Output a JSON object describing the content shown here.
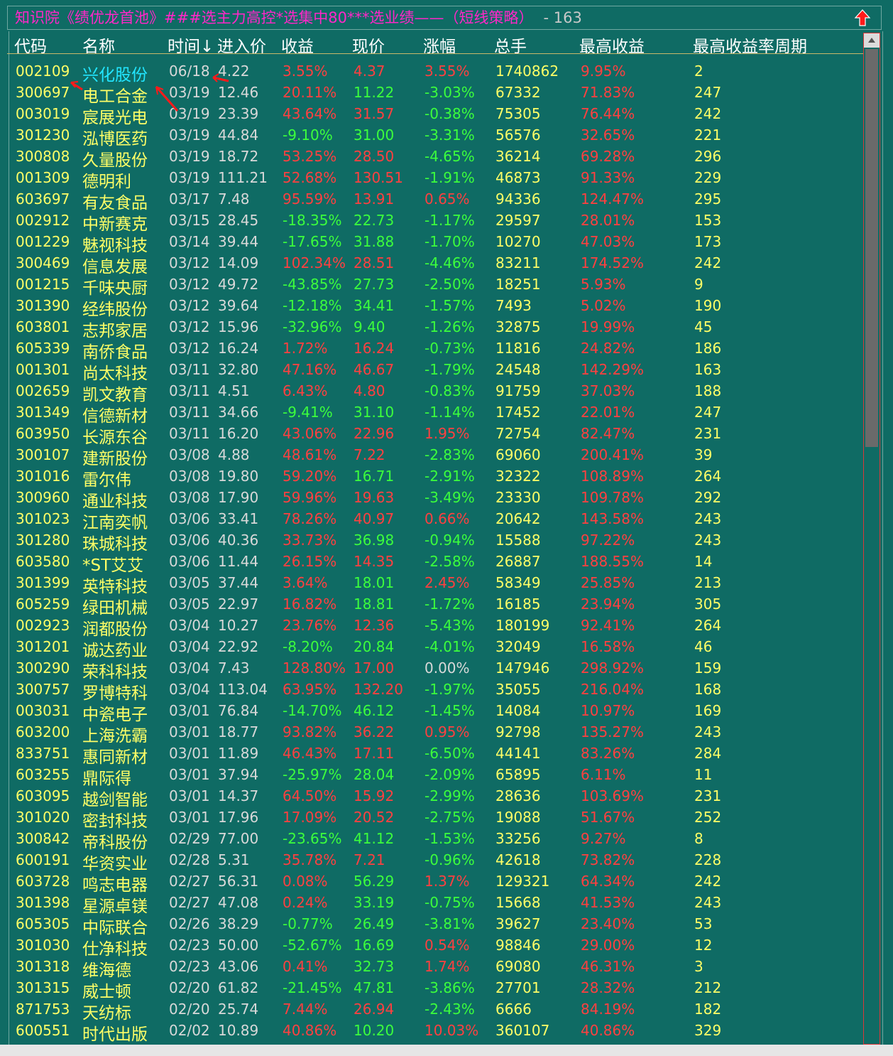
{
  "title": {
    "text": "知识院《绩优龙首池》###选主力高控*选集中80***选业绩——（短线策略）",
    "count": "- 163"
  },
  "headers": {
    "code": "代码",
    "name": "名称",
    "time": "时间↓",
    "entry": "进入价",
    "ret": "收益",
    "price": "现价",
    "chg": "涨幅",
    "vol": "总手",
    "max": "最高收益",
    "period": "最高收益率周期"
  },
  "icons": {
    "up": "up-arrow-icon",
    "annotation": "red-arrow-annotation"
  },
  "colors": {
    "background": "#0f6b64",
    "title": "#ff27c8",
    "code": "#ffff66",
    "positive": "#ff4040",
    "negative": "#3cff3c",
    "selected_name": "#22e5ff"
  },
  "rows": [
    {
      "code": "002109",
      "name": "兴化股份",
      "time": "06/18",
      "entry": "4.22",
      "ret": "3.55%",
      "price": "4.37",
      "chg": "3.55%",
      "vol": "1740862",
      "max": "9.95%",
      "period": "2",
      "sel": true
    },
    {
      "code": "300697",
      "name": "电工合金",
      "time": "03/19",
      "entry": "12.46",
      "ret": "20.11%",
      "price": "11.22",
      "chg": "-3.03%",
      "vol": "67332",
      "max": "71.83%",
      "period": "247"
    },
    {
      "code": "003019",
      "name": "宸展光电",
      "time": "03/19",
      "entry": "23.39",
      "ret": "43.64%",
      "price": "31.57",
      "chg": "-0.38%",
      "vol": "75305",
      "max": "76.44%",
      "period": "242"
    },
    {
      "code": "301230",
      "name": "泓博医药",
      "time": "03/19",
      "entry": "44.84",
      "ret": "-9.10%",
      "price": "31.00",
      "chg": "-3.31%",
      "vol": "56576",
      "max": "32.65%",
      "period": "221"
    },
    {
      "code": "300808",
      "name": "久量股份",
      "time": "03/19",
      "entry": "18.72",
      "ret": "53.25%",
      "price": "28.50",
      "chg": "-4.65%",
      "vol": "36214",
      "max": "69.28%",
      "period": "296"
    },
    {
      "code": "001309",
      "name": "德明利",
      "time": "03/19",
      "entry": "111.21",
      "ret": "52.68%",
      "price": "130.51",
      "chg": "-1.91%",
      "vol": "46873",
      "max": "91.33%",
      "period": "229"
    },
    {
      "code": "603697",
      "name": "有友食品",
      "time": "03/17",
      "entry": "7.48",
      "ret": "95.59%",
      "price": "13.91",
      "chg": "0.65%",
      "vol": "94336",
      "max": "124.47%",
      "period": "295"
    },
    {
      "code": "002912",
      "name": "中新赛克",
      "time": "03/15",
      "entry": "28.45",
      "ret": "-18.35%",
      "price": "22.73",
      "chg": "-1.17%",
      "vol": "29597",
      "max": "28.01%",
      "period": "153"
    },
    {
      "code": "001229",
      "name": "魅视科技",
      "time": "03/14",
      "entry": "39.44",
      "ret": "-17.65%",
      "price": "31.88",
      "chg": "-1.70%",
      "vol": "10270",
      "max": "47.03%",
      "period": "173"
    },
    {
      "code": "300469",
      "name": "信息发展",
      "time": "03/12",
      "entry": "14.09",
      "ret": "102.34%",
      "price": "28.51",
      "chg": "-4.46%",
      "vol": "83211",
      "max": "174.52%",
      "period": "242"
    },
    {
      "code": "001215",
      "name": "千味央厨",
      "time": "03/12",
      "entry": "49.72",
      "ret": "-43.85%",
      "price": "27.73",
      "chg": "-2.50%",
      "vol": "18251",
      "max": "5.93%",
      "period": "9"
    },
    {
      "code": "301390",
      "name": "经纬股份",
      "time": "03/12",
      "entry": "39.64",
      "ret": "-12.18%",
      "price": "34.41",
      "chg": "-1.57%",
      "vol": "7493",
      "max": "5.02%",
      "period": "190"
    },
    {
      "code": "603801",
      "name": "志邦家居",
      "time": "03/12",
      "entry": "15.96",
      "ret": "-32.96%",
      "price": "9.40",
      "chg": "-1.26%",
      "vol": "32875",
      "max": "19.99%",
      "period": "45"
    },
    {
      "code": "605339",
      "name": "南侨食品",
      "time": "03/12",
      "entry": "16.24",
      "ret": "1.72%",
      "price": "16.24",
      "chg": "-0.73%",
      "vol": "11816",
      "max": "24.82%",
      "period": "186"
    },
    {
      "code": "001301",
      "name": "尚太科技",
      "time": "03/11",
      "entry": "32.80",
      "ret": "47.16%",
      "price": "46.67",
      "chg": "-1.79%",
      "vol": "24548",
      "max": "142.29%",
      "period": "163"
    },
    {
      "code": "002659",
      "name": "凯文教育",
      "time": "03/11",
      "entry": "4.51",
      "ret": "6.43%",
      "price": "4.80",
      "chg": "-0.83%",
      "vol": "91759",
      "max": "37.03%",
      "period": "188"
    },
    {
      "code": "301349",
      "name": "信德新材",
      "time": "03/11",
      "entry": "34.66",
      "ret": "-9.41%",
      "price": "31.10",
      "chg": "-1.14%",
      "vol": "17452",
      "max": "22.01%",
      "period": "247"
    },
    {
      "code": "603950",
      "name": "长源东谷",
      "time": "03/11",
      "entry": "16.20",
      "ret": "43.06%",
      "price": "22.96",
      "chg": "1.95%",
      "vol": "72754",
      "max": "82.47%",
      "period": "231"
    },
    {
      "code": "300107",
      "name": "建新股份",
      "time": "03/08",
      "entry": "4.88",
      "ret": "48.61%",
      "price": "7.22",
      "chg": "-2.83%",
      "vol": "69060",
      "max": "200.41%",
      "period": "39"
    },
    {
      "code": "301016",
      "name": "雷尔伟",
      "time": "03/08",
      "entry": "19.80",
      "ret": "59.20%",
      "price": "16.71",
      "chg": "-2.91%",
      "vol": "32322",
      "max": "108.89%",
      "period": "264"
    },
    {
      "code": "300960",
      "name": "通业科技",
      "time": "03/08",
      "entry": "17.90",
      "ret": "59.96%",
      "price": "19.63",
      "chg": "-3.49%",
      "vol": "23330",
      "max": "109.78%",
      "period": "292"
    },
    {
      "code": "301023",
      "name": "江南奕帆",
      "time": "03/06",
      "entry": "33.41",
      "ret": "78.26%",
      "price": "40.97",
      "chg": "0.66%",
      "vol": "20642",
      "max": "143.58%",
      "period": "243"
    },
    {
      "code": "301280",
      "name": "珠城科技",
      "time": "03/06",
      "entry": "40.36",
      "ret": "33.73%",
      "price": "36.98",
      "chg": "-0.94%",
      "vol": "15588",
      "max": "97.22%",
      "period": "243"
    },
    {
      "code": "603580",
      "name": "*ST艾艾",
      "time": "03/06",
      "entry": "11.44",
      "ret": "26.15%",
      "price": "14.35",
      "chg": "-2.58%",
      "vol": "26887",
      "max": "188.55%",
      "period": "14"
    },
    {
      "code": "301399",
      "name": "英特科技",
      "time": "03/05",
      "entry": "37.44",
      "ret": "3.64%",
      "price": "18.01",
      "chg": "2.45%",
      "vol": "58349",
      "max": "25.85%",
      "period": "213"
    },
    {
      "code": "605259",
      "name": "绿田机械",
      "time": "03/05",
      "entry": "22.97",
      "ret": "16.82%",
      "price": "18.81",
      "chg": "-1.72%",
      "vol": "16185",
      "max": "23.94%",
      "period": "305"
    },
    {
      "code": "002923",
      "name": "润都股份",
      "time": "03/04",
      "entry": "10.27",
      "ret": "23.76%",
      "price": "12.36",
      "chg": "-5.43%",
      "vol": "180199",
      "max": "92.41%",
      "period": "264"
    },
    {
      "code": "301201",
      "name": "诚达药业",
      "time": "03/04",
      "entry": "22.92",
      "ret": "-8.20%",
      "price": "20.84",
      "chg": "-4.01%",
      "vol": "32049",
      "max": "16.58%",
      "period": "46"
    },
    {
      "code": "300290",
      "name": "荣科科技",
      "time": "03/04",
      "entry": "7.43",
      "ret": "128.80%",
      "price": "17.00",
      "chg": "0.00%",
      "vol": "147946",
      "max": "298.92%",
      "period": "159"
    },
    {
      "code": "300757",
      "name": "罗博特科",
      "time": "03/04",
      "entry": "113.04",
      "ret": "63.95%",
      "price": "132.20",
      "chg": "-1.97%",
      "vol": "35055",
      "max": "216.04%",
      "period": "168"
    },
    {
      "code": "003031",
      "name": "中瓷电子",
      "time": "03/01",
      "entry": "76.84",
      "ret": "-14.70%",
      "price": "46.12",
      "chg": "-1.45%",
      "vol": "14084",
      "max": "10.97%",
      "period": "169"
    },
    {
      "code": "603200",
      "name": "上海洗霸",
      "time": "03/01",
      "entry": "18.77",
      "ret": "93.82%",
      "price": "36.22",
      "chg": "0.95%",
      "vol": "92798",
      "max": "135.27%",
      "period": "243"
    },
    {
      "code": "833751",
      "name": "惠同新材",
      "time": "03/01",
      "entry": "11.89",
      "ret": "46.43%",
      "price": "17.11",
      "chg": "-6.50%",
      "vol": "44141",
      "max": "83.26%",
      "period": "284"
    },
    {
      "code": "603255",
      "name": "鼎际得",
      "time": "03/01",
      "entry": "37.94",
      "ret": "-25.97%",
      "price": "28.04",
      "chg": "-2.09%",
      "vol": "65895",
      "max": "6.11%",
      "period": "11"
    },
    {
      "code": "603095",
      "name": "越剑智能",
      "time": "03/01",
      "entry": "14.37",
      "ret": "64.50%",
      "price": "15.92",
      "chg": "-2.99%",
      "vol": "28636",
      "max": "103.69%",
      "period": "231"
    },
    {
      "code": "301020",
      "name": "密封科技",
      "time": "03/01",
      "entry": "17.96",
      "ret": "17.09%",
      "price": "20.52",
      "chg": "-2.75%",
      "vol": "19088",
      "max": "51.67%",
      "period": "252"
    },
    {
      "code": "300842",
      "name": "帝科股份",
      "time": "02/29",
      "entry": "77.00",
      "ret": "-23.65%",
      "price": "41.12",
      "chg": "-1.53%",
      "vol": "33256",
      "max": "9.27%",
      "period": "8"
    },
    {
      "code": "600191",
      "name": "华资实业",
      "time": "02/28",
      "entry": "5.31",
      "ret": "35.78%",
      "price": "7.21",
      "chg": "-0.96%",
      "vol": "42618",
      "max": "73.82%",
      "period": "228"
    },
    {
      "code": "603728",
      "name": "鸣志电器",
      "time": "02/27",
      "entry": "56.31",
      "ret": "0.08%",
      "price": "56.29",
      "chg": "1.37%",
      "vol": "129321",
      "max": "64.34%",
      "period": "242"
    },
    {
      "code": "301398",
      "name": "星源卓镁",
      "time": "02/27",
      "entry": "47.08",
      "ret": "0.24%",
      "price": "33.19",
      "chg": "-0.75%",
      "vol": "15668",
      "max": "41.53%",
      "period": "243"
    },
    {
      "code": "605305",
      "name": "中际联合",
      "time": "02/26",
      "entry": "38.29",
      "ret": "-0.77%",
      "price": "26.49",
      "chg": "-3.81%",
      "vol": "39627",
      "max": "23.40%",
      "period": "53"
    },
    {
      "code": "301030",
      "name": "仕净科技",
      "time": "02/23",
      "entry": "50.00",
      "ret": "-52.67%",
      "price": "16.69",
      "chg": "0.54%",
      "vol": "98846",
      "max": "29.00%",
      "period": "12"
    },
    {
      "code": "301318",
      "name": "维海德",
      "time": "02/23",
      "entry": "43.06",
      "ret": "0.41%",
      "price": "32.73",
      "chg": "1.74%",
      "vol": "69080",
      "max": "46.31%",
      "period": "3"
    },
    {
      "code": "301315",
      "name": "威士顿",
      "time": "02/20",
      "entry": "61.82",
      "ret": "-21.45%",
      "price": "47.81",
      "chg": "-3.86%",
      "vol": "27701",
      "max": "28.32%",
      "period": "212"
    },
    {
      "code": "871753",
      "name": "天纺标",
      "time": "02/20",
      "entry": "25.74",
      "ret": "7.44%",
      "price": "26.94",
      "chg": "-2.43%",
      "vol": "6666",
      "max": "84.19%",
      "period": "182"
    },
    {
      "code": "600551",
      "name": "时代出版",
      "time": "02/02",
      "entry": "10.89",
      "ret": "40.86%",
      "price": "10.20",
      "chg": "10.03%",
      "vol": "360107",
      "max": "40.86%",
      "period": "329"
    }
  ]
}
